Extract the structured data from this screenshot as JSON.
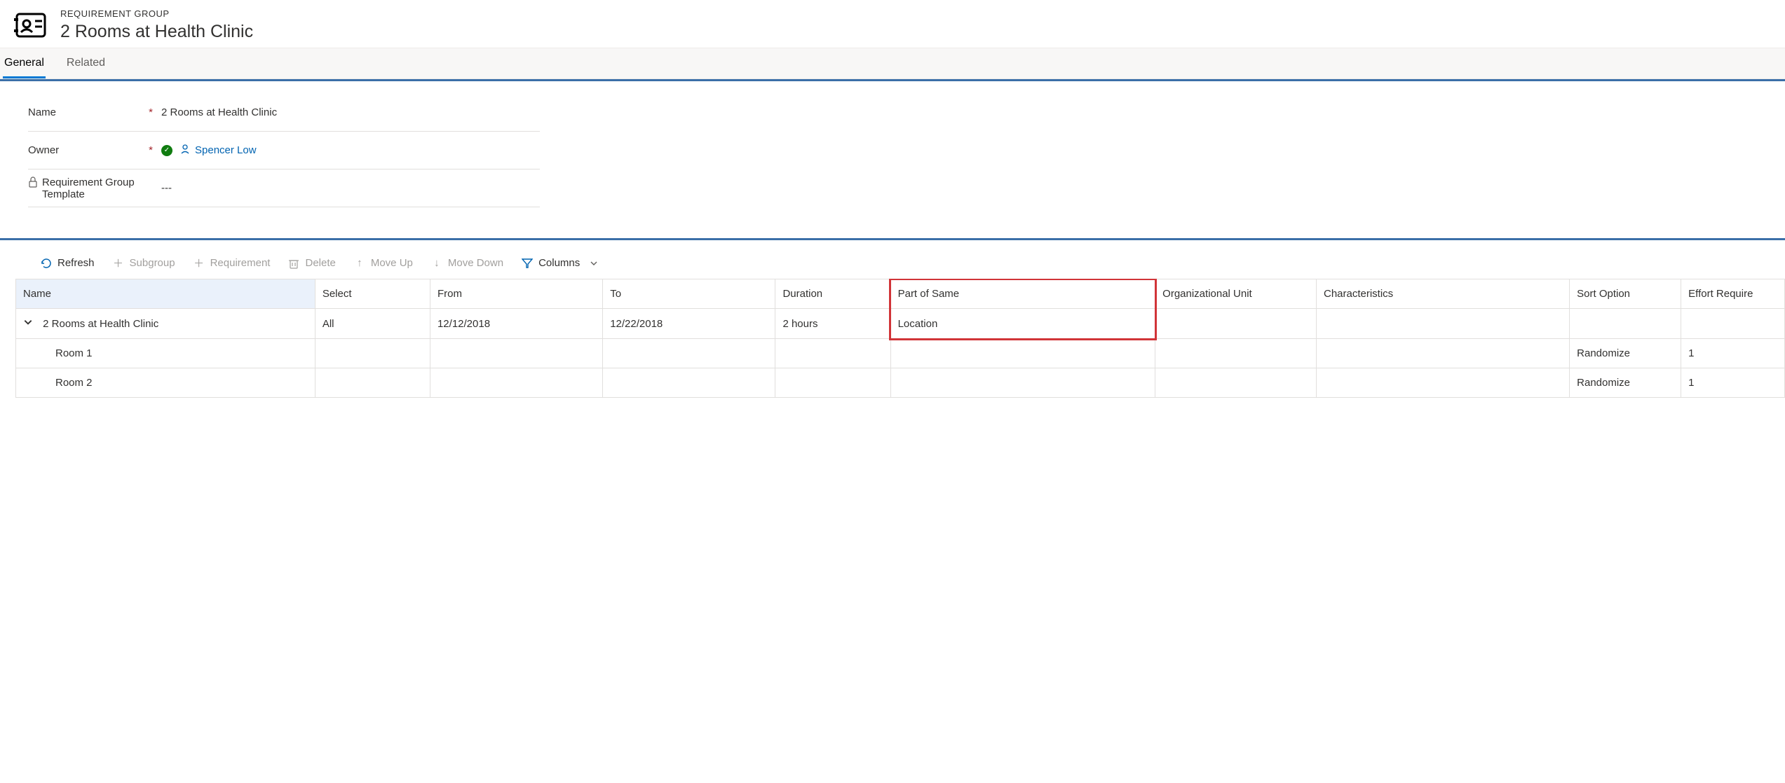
{
  "header": {
    "entity_label": "REQUIREMENT GROUP",
    "title": "2 Rooms at Health Clinic"
  },
  "tabs": {
    "general": "General",
    "related": "Related"
  },
  "form": {
    "name_label": "Name",
    "name_value": "2 Rooms at Health Clinic",
    "owner_label": "Owner",
    "owner_value": "Spencer Low",
    "template_label": "Requirement Group Template",
    "template_value": "---"
  },
  "toolbar": {
    "refresh": "Refresh",
    "subgroup": "Subgroup",
    "requirement": "Requirement",
    "delete": "Delete",
    "move_up": "Move Up",
    "move_down": "Move Down",
    "columns": "Columns"
  },
  "grid": {
    "headers": {
      "name": "Name",
      "select": "Select",
      "from": "From",
      "to": "To",
      "duration": "Duration",
      "part_of_same": "Part of Same",
      "org_unit": "Organizational Unit",
      "characteristics": "Characteristics",
      "sort_option": "Sort Option",
      "effort_required": "Effort Require"
    },
    "rows": [
      {
        "name": "2 Rooms at Health Clinic",
        "select": "All",
        "from": "12/12/2018",
        "to": "12/22/2018",
        "duration": "2 hours",
        "part_of_same": "Location",
        "org_unit": "",
        "characteristics": "",
        "sort_option": "",
        "effort_required": "",
        "is_group": true
      },
      {
        "name": "Room 1",
        "select": "",
        "from": "",
        "to": "",
        "duration": "",
        "part_of_same": "",
        "org_unit": "",
        "characteristics": "",
        "sort_option": "Randomize",
        "effort_required": "1",
        "is_child": true
      },
      {
        "name": "Room 2",
        "select": "",
        "from": "",
        "to": "",
        "duration": "",
        "part_of_same": "",
        "org_unit": "",
        "characteristics": "",
        "sort_option": "Randomize",
        "effort_required": "1",
        "is_child": true
      }
    ]
  }
}
